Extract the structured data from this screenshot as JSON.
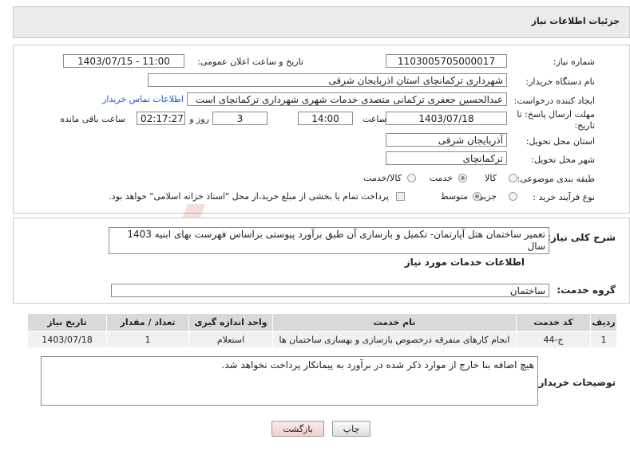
{
  "header": {
    "title": "جزئیات اطلاعات نیاز"
  },
  "need_number": {
    "label": "شماره نیاز:",
    "value": "1103005705000017"
  },
  "announce_datetime": {
    "label": "تاریخ و ساعت اعلان عمومی:",
    "value": "1403/07/15 - 11:00"
  },
  "buyer_org": {
    "label": "نام دستگاه خریدار:",
    "value": "شهرداری ترکمانچای استان اذربایجان شرقی"
  },
  "creator": {
    "label": "ایجاد کننده درخواست:",
    "value": "عبدالحسین  جعفری ترکمانی  متصدی خدمات شهری  شهرداری ترکمانچای است",
    "contact_link": "اطلاعات تماس خریدار"
  },
  "deadline": {
    "label_line1": "مهلت ارسال پاسخ: تا",
    "label_line2": "تاریخ:",
    "date": "1403/07/18",
    "time_label": "ساعت",
    "time": "14:00",
    "days": "3",
    "days_label": "روز و",
    "remaining": "02:17:27",
    "remaining_label": "ساعت باقی مانده"
  },
  "province": {
    "label": "استان محل تحویل:",
    "value": "آذربایجان شرقی"
  },
  "city": {
    "label": "شهر محل تحویل:",
    "value": "ترکمانچای"
  },
  "category": {
    "label": "طبقه بندی موضوعی:",
    "options": [
      "کالا",
      "خدمت",
      "کالا/خدمت"
    ],
    "selected": "خدمت"
  },
  "process_type": {
    "label": "نوع فرآیند خرید :",
    "options": [
      "جزیی",
      "متوسط"
    ],
    "selected": "متوسط",
    "payment_note": "پرداخت تمام یا بخشی از مبلغ خرید،از محل \"اسناد خزانه اسلامی\" خواهد بود."
  },
  "summary": {
    "label": "شرح کلی نیاز:",
    "value": "تعمیر ساختمان هتل آپارتمان- تکمیل و بازسازی آن طبق برآورد پیوستی براساس فهرست بهای ابنیه 1403 سال"
  },
  "services_section_title": "اطلاعات خدمات مورد نیاز",
  "service_group": {
    "label": "گروه خدمت:",
    "value": "ساختمان"
  },
  "table": {
    "headers": [
      "ردیف",
      "کد خدمت",
      "نام خدمت",
      "واحد اندازه گیری",
      "تعداد / مقدار",
      "تاریخ نیاز"
    ],
    "rows": [
      [
        "1",
        "ج-44",
        "انجام کارهای متفرقه درخصوص بازسازی و بهسازی ساختمان ها",
        "استعلام",
        "1",
        "1403/07/18"
      ]
    ]
  },
  "buyer_notes": {
    "label": "توضیحات خریدار:",
    "value": "هیچ اضافه بنا خارج از موارد ذکر شده در برآورد به پیمانکار پرداخت نخواهد شد."
  },
  "buttons": {
    "print": "چاپ",
    "back": "بازگشت"
  },
  "watermark_text": "AriaTender.neT",
  "colors": {
    "link": "#1a5ec9",
    "back_button_bg": "#f4dede",
    "watermark": "#c0392b"
  }
}
